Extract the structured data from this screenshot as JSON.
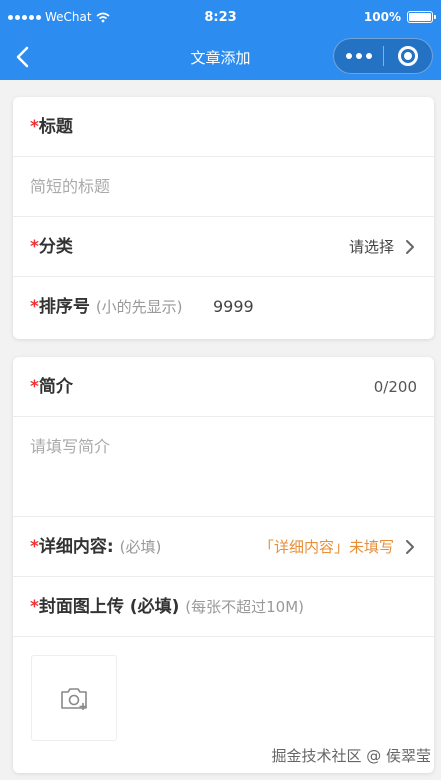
{
  "status": {
    "carrier": "WeChat",
    "time": "8:23",
    "battery": "100%"
  },
  "nav": {
    "title": "文章添加"
  },
  "form": {
    "title": {
      "required_mark": "*",
      "label": "标题",
      "placeholder": "简短的标题"
    },
    "category": {
      "required_mark": "*",
      "label": "分类",
      "value": "请选择"
    },
    "sort": {
      "required_mark": "*",
      "label": "排序号",
      "hint": "(小的先显示)",
      "value": "9999"
    },
    "summary": {
      "required_mark": "*",
      "label": "简介",
      "counter": "0/200",
      "placeholder": "请填写简介"
    },
    "detail": {
      "required_mark": "*",
      "label": "详细内容:",
      "hint": "(必填)",
      "status": "「详细内容」未填写"
    },
    "cover": {
      "required_mark": "*",
      "label": "封面图上传 (必填)",
      "hint": "(每张不超过10M)"
    }
  },
  "watermark": "掘金技术社区 @ 侯翠莹"
}
